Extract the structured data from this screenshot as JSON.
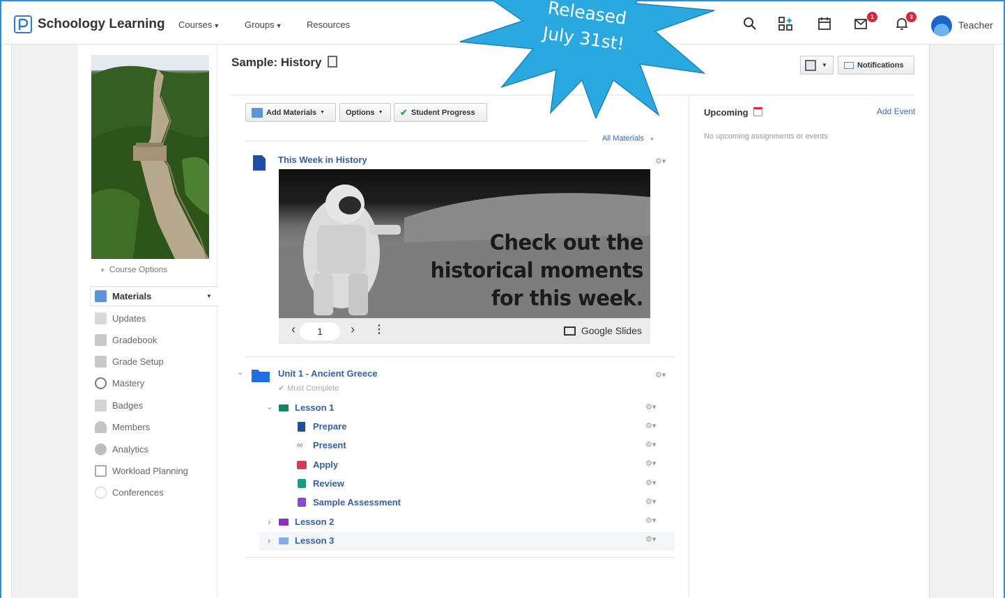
{
  "app": {
    "brand": "Schoology Learning",
    "user": "Teacher"
  },
  "nav": {
    "courses": "Courses",
    "groups": "Groups",
    "resources": "Resources"
  },
  "badges": {
    "messages": "1",
    "notifications": "3"
  },
  "sidebar": {
    "course_options": "Course Options",
    "items": [
      {
        "label": "Materials",
        "icon": "materials-icon",
        "active": true
      },
      {
        "label": "Updates",
        "icon": "updates-icon"
      },
      {
        "label": "Gradebook",
        "icon": "gradebook-icon"
      },
      {
        "label": "Grade Setup",
        "icon": "grade-setup-icon"
      },
      {
        "label": "Mastery",
        "icon": "mastery-icon"
      },
      {
        "label": "Badges",
        "icon": "badges-icon"
      },
      {
        "label": "Members",
        "icon": "members-icon"
      },
      {
        "label": "Analytics",
        "icon": "analytics-icon"
      },
      {
        "label": "Workload Planning",
        "icon": "workload-icon"
      },
      {
        "label": "Conferences",
        "icon": "conferences-icon"
      }
    ]
  },
  "main": {
    "title": "Sample: History",
    "toolbar": {
      "add_materials": "Add Materials",
      "options": "Options",
      "student_progress": "Student Progress"
    },
    "filter": "All Materials",
    "page": {
      "title": "This Week in History",
      "slide_text": [
        "Check out the",
        "historical moments",
        "for this week."
      ],
      "slide_page": "1",
      "slide_source": "Google Slides"
    },
    "folder": {
      "title": "Unit 1 - Ancient Greece",
      "requirement": "Must Complete",
      "lesson1": "Lesson 1",
      "items": [
        {
          "label": "Prepare",
          "icon": "document-icon",
          "color": "#1f4f9e"
        },
        {
          "label": "Present",
          "icon": "link-icon",
          "color": "#3a86d8"
        },
        {
          "label": "Apply",
          "icon": "discussion-icon",
          "color": "#d83a4f"
        },
        {
          "label": "Review",
          "icon": "assignment-icon",
          "color": "#1a9b7c"
        },
        {
          "label": "Sample Assessment",
          "icon": "assessment-icon",
          "color": "#8a49c6"
        }
      ],
      "lesson2": "Lesson 2",
      "lesson3": "Lesson 3"
    }
  },
  "right": {
    "view_button": "",
    "notifications": "Notifications",
    "upcoming": "Upcoming",
    "add_event": "Add Event",
    "no_events": "No upcoming assignments or events"
  },
  "burst": {
    "line1": "Released",
    "line2": "July 31st!"
  },
  "colors": {
    "accent": "#2b8fd6",
    "link": "#345ea7",
    "burst": "#29a9e0",
    "badge": "#d8263a"
  }
}
